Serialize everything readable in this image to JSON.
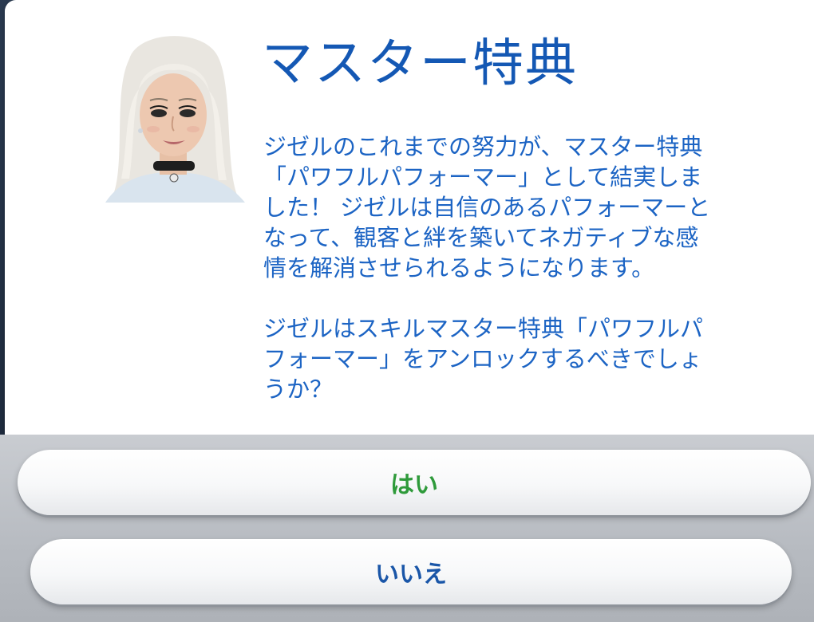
{
  "dialog": {
    "title": "マスター特典",
    "paragraph1": "ジゼルのこれまでの努力が、マスター特典\n「パワフルパフォーマー」として結実しま\nした！ ジゼルは自信のあるパフォーマーと\nなって、観客と絆を築いてネガティブな感\n情を解消させられるようになります。",
    "paragraph2": "ジゼルはスキルマスター特典「パワフルパ\nフォーマー」をアンロックするべきでしょ\nうか？"
  },
  "buttons": {
    "yes_label": "はい",
    "no_label": "いいえ"
  },
  "colors": {
    "title": "#1458b4",
    "body_text": "#1c64c4",
    "yes_text": "#2e9a3a",
    "no_text": "#1a56a8"
  },
  "icons": {
    "portrait": "sim-portrait"
  }
}
